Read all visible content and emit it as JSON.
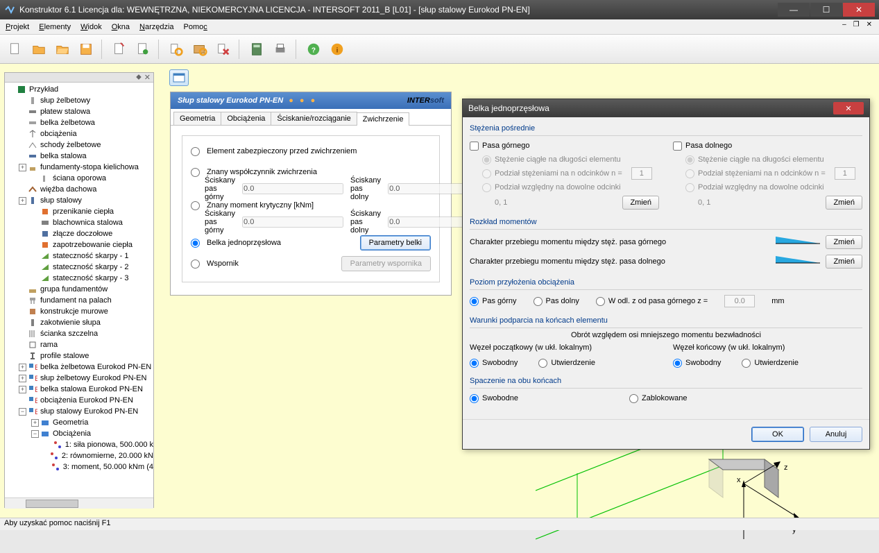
{
  "app": {
    "title": "Konstruktor 6.1 Licencja dla: WEWNĘTRZNA, NIEKOMERCYJNA LICENCJA - INTERSOFT 2011_B [L01] - [słup stalowy Eurokod PN-EN]"
  },
  "menu": {
    "items": [
      "Projekt",
      "Elementy",
      "Widok",
      "Okna",
      "Narzędzia",
      "Pomoc"
    ]
  },
  "tree": {
    "root": "Przykład",
    "nodes": [
      "słup żelbetowy",
      "płatew stalowa",
      "belka żelbetowa",
      "obciążenia",
      "schody żelbetowe",
      "belka stalowa",
      "fundamenty-stopa kielichowa",
      "ściana oporowa",
      "więźba dachowa",
      "słup stalowy",
      "przenikanie ciepła",
      "blachownica stalowa",
      "złącze doczołowe",
      "zapotrzebowanie ciepła",
      "stateczność skarpy - 1",
      "stateczność skarpy - 2",
      "stateczność skarpy - 3",
      "grupa fundamentów",
      "fundament na palach",
      "konstrukcje murowe",
      "zakotwienie słupa",
      "ścianka szczelna",
      "rama",
      "profile stalowe",
      "belka żelbetowa Eurokod PN-EN",
      "słup żelbetowy Eurokod PN-EN",
      "belka stalowa Eurokod PN-EN",
      "obciążenia Eurokod PN-EN",
      "słup stalowy Eurokod PN-EN"
    ],
    "sub": {
      "geo": "Geometria",
      "obc": "Obciążenia",
      "l1": "1: siła pionowa, 500.000 k",
      "l2": "2: równomierne, 20.000 kN",
      "l3": "3: moment, 50.000 kNm (4"
    }
  },
  "form": {
    "title": "Słup stalowy Eurokod PN-EN",
    "brand": "INTERsoft",
    "tabs": {
      "t1": "Geometria",
      "t2": "Obciążenia",
      "t3": "Ściskanie/rozciąganie",
      "t4": "Zwichrzenie"
    },
    "r1": "Element zabezpieczony przed zwichrzeniem",
    "r2": "Znany współczynnik zwichrzenia",
    "l_sg": "Ściskany pas górny",
    "l_sd": "Ściskany pas dolny",
    "v": "0.0",
    "r3": "Znany  moment krytyczny [kNm]",
    "r4": "Belka jednoprzęsłowa",
    "b4": "Parametry belki",
    "r5": "Wspornik",
    "b5": "Parametry wspornika"
  },
  "dlg": {
    "title": "Belka jednoprzęsłowa",
    "g1": "Stężenia pośrednie",
    "c1": "Pasa górnego",
    "c2": "Pasa dolnego",
    "ra": "Stężenie ciągłe na długości elementu",
    "rb": "Podział stężeniami na n odcinków n =",
    "nval": "1",
    "rc": "Podział względny na dowolne odcinki",
    "rcv": "0, 1",
    "zm": "Zmień",
    "g2": "Rozkład momentów",
    "m1": "Charakter przebiegu momentu między stęż. pasa górnego",
    "m2": "Charakter przebiegu momentu między stęż. pasa dolnego",
    "g3": "Poziom przyłożenia obciążenia",
    "p1": "Pas górny",
    "p2": "Pas dolny",
    "p3": "W odl. z od pasa górnego z =",
    "pv": "0.0",
    "pu": "mm",
    "g4": "Warunki podparcia na końcach elementu",
    "g4s": "Obrót względem osi mniejszego momentu bezwładności",
    "w1": "Węzeł początkowy (w ukł. lokalnym)",
    "w2": "Węzeł końcowy (w ukł. lokalnym)",
    "sw": "Swobodny",
    "ut": "Utwierdzenie",
    "g5": "Spaczenie na obu końcach",
    "sp1": "Swobodne",
    "sp2": "Zablokowane",
    "ok": "OK",
    "cancel": "Anuluj"
  },
  "status": "Aby uzyskać pomoc naciśnij F1"
}
